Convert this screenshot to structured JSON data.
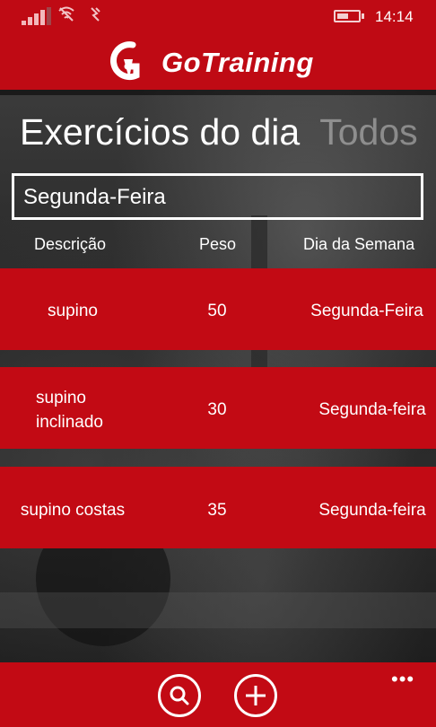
{
  "status_bar": {
    "time": "14:14",
    "signal_level": 0.8,
    "battery_level": 0.55
  },
  "header": {
    "app_name": "GoTraining",
    "brand_color": "#bf0a14"
  },
  "pivot": {
    "active_label": "Exercícios do dia",
    "inactive_label": "Todos"
  },
  "day_selector": {
    "value": "Segunda-Feira"
  },
  "table": {
    "columns": [
      "Descrição",
      "Peso",
      "Dia da Semana"
    ],
    "rows": [
      {
        "descricao": "supino",
        "peso": "50",
        "dia": "Segunda-Feira"
      },
      {
        "descricao": "supino inclinado",
        "peso": "30",
        "dia": "Segunda-feira"
      },
      {
        "descricao": "supino costas",
        "peso": "35",
        "dia": "Segunda-feira"
      }
    ]
  },
  "app_bar": {
    "buttons": [
      {
        "icon": "search-icon"
      },
      {
        "icon": "add-icon"
      }
    ],
    "more_label": "•••"
  }
}
